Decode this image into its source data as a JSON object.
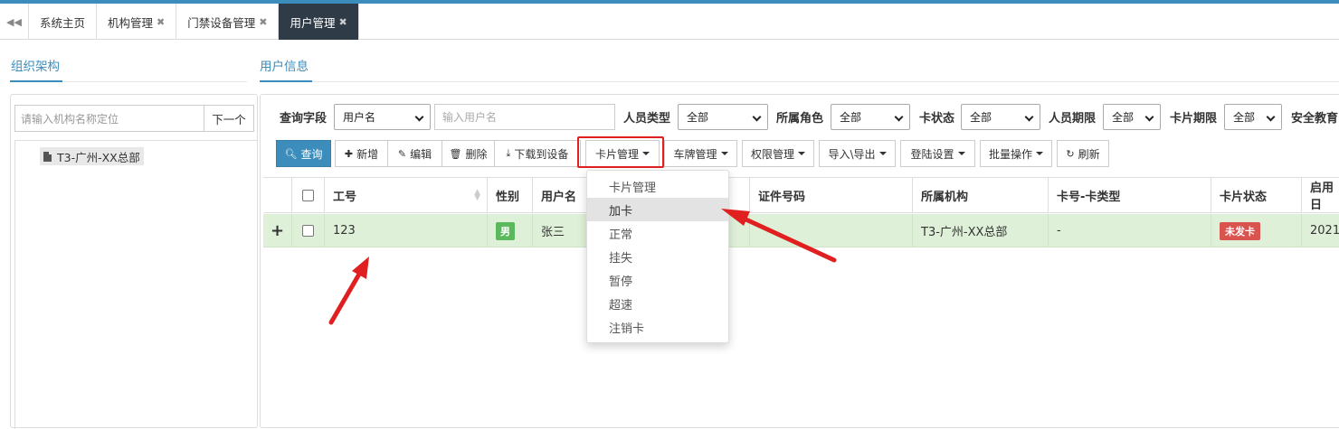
{
  "tabs": [
    {
      "label": "系统主页",
      "closable": false
    },
    {
      "label": "机构管理",
      "closable": true
    },
    {
      "label": "门禁设备管理",
      "closable": true
    },
    {
      "label": "用户管理",
      "closable": true,
      "active": true
    }
  ],
  "left": {
    "section_title": "组织架构",
    "search_placeholder": "请输入机构名称定位",
    "next_button": "下一个",
    "tree": [
      {
        "label": "T3-广州-XX总部"
      }
    ]
  },
  "right": {
    "section_title": "用户信息",
    "filters": {
      "query_field_label": "查询字段",
      "query_field_value": "用户名",
      "query_input_placeholder": "输入用户名",
      "person_type_label": "人员类型",
      "person_type_value": "全部",
      "role_label": "所属角色",
      "role_value": "全部",
      "card_status_label": "卡状态",
      "card_status_value": "全部",
      "person_term_label": "人员期限",
      "person_term_value": "全部",
      "card_term_label": "卡片期限",
      "card_term_value": "全部",
      "safety_label": "安全教育"
    },
    "toolbar": {
      "query": "查询",
      "add": "新增",
      "edit": "编辑",
      "delete": "删除",
      "download": "下载到设备",
      "card_mgmt": "卡片管理",
      "plate_mgmt": "车牌管理",
      "perm_mgmt": "权限管理",
      "import_export": "导入\\导出",
      "login_settings": "登陆设置",
      "batch_ops": "批量操作",
      "refresh": "刷新"
    },
    "table": {
      "columns": [
        "工号",
        "性别",
        "用户名",
        "证件号码",
        "所属机构",
        "卡号-卡类型",
        "卡片状态",
        "启用日"
      ],
      "rows": [
        {
          "expand": "+",
          "id": "123",
          "gender": "男",
          "name": "张三",
          "id_number": "",
          "org": "T3-广州-XX总部",
          "card": "-",
          "card_status": "未发卡",
          "start": "2021"
        }
      ]
    },
    "card_menu": {
      "header": "卡片管理",
      "items": [
        "加卡",
        "正常",
        "挂失",
        "暂停",
        "超速",
        "注销卡"
      ]
    }
  },
  "colors": {
    "accent": "#3c8dbc",
    "active_tab": "#2f3b47",
    "row_highlight": "#dff0d8",
    "male": "#5cb85c",
    "card_status": "#d9534f",
    "annotation": "#e02020"
  }
}
